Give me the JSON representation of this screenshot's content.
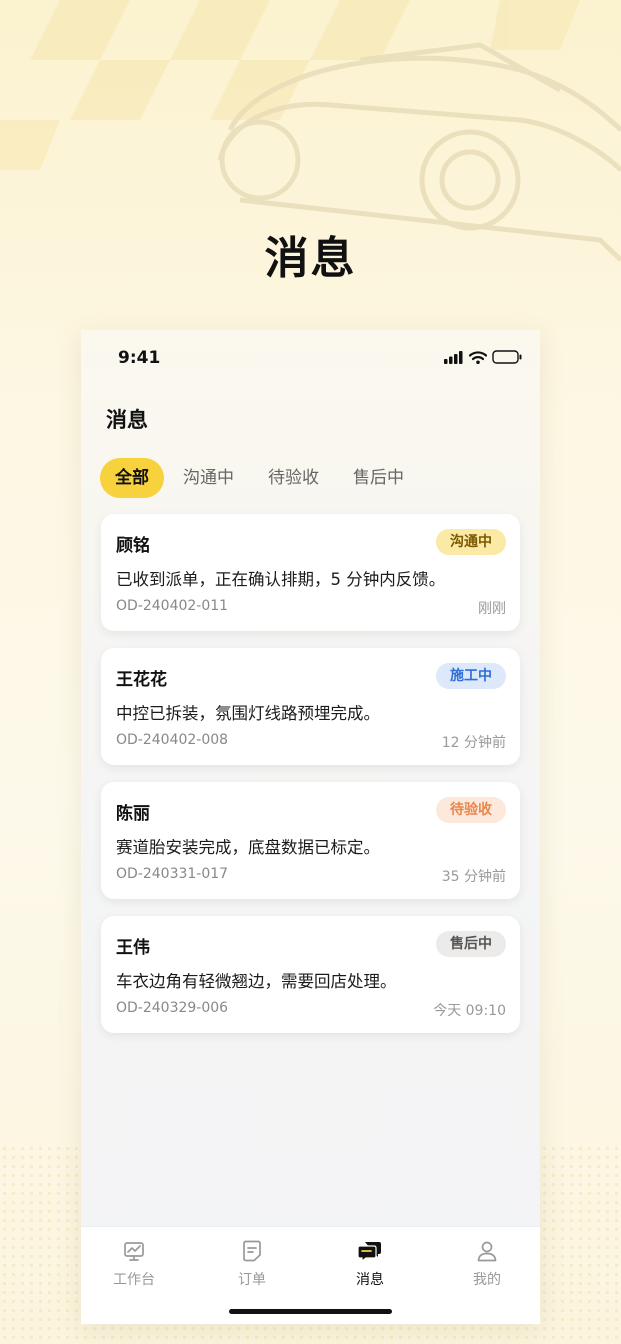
{
  "hero": {
    "title": "消息"
  },
  "status_bar": {
    "time": "9:41"
  },
  "page": {
    "title": "消息"
  },
  "tabs": [
    {
      "label": "全部",
      "active": true
    },
    {
      "label": "沟通中",
      "active": false
    },
    {
      "label": "待验收",
      "active": false
    },
    {
      "label": "售后中",
      "active": false
    }
  ],
  "messages": [
    {
      "name": "顾铭",
      "status": "沟通中",
      "text": "已收到派单，正在确认排期，5 分钟内反馈。",
      "order_id": "OD-240402-011",
      "time": "刚刚"
    },
    {
      "name": "王花花",
      "status": "施工中",
      "text": "中控已拆装，氛围灯线路预埋完成。",
      "order_id": "OD-240402-008",
      "time": "12 分钟前"
    },
    {
      "name": "陈丽",
      "status": "待验收",
      "text": "赛道胎安装完成，底盘数据已标定。",
      "order_id": "OD-240331-017",
      "time": "35 分钟前"
    },
    {
      "name": "王伟",
      "status": "售后中",
      "text": "车衣边角有轻微翘边，需要回店处理。",
      "order_id": "OD-240329-006",
      "time": "今天 09:10"
    }
  ],
  "tabbar": [
    {
      "label": "工作台",
      "icon": "dashboard-icon",
      "active": false
    },
    {
      "label": "订单",
      "icon": "document-icon",
      "active": false
    },
    {
      "label": "消息",
      "icon": "chat-icon",
      "active": true
    },
    {
      "label": "我的",
      "icon": "user-icon",
      "active": false
    }
  ],
  "colors": {
    "accent": "#f7d23c",
    "status_communicating": "#fbe9a6",
    "status_working": "#dde8fb",
    "status_check": "#fde8dc",
    "status_after": "#ecebea"
  }
}
